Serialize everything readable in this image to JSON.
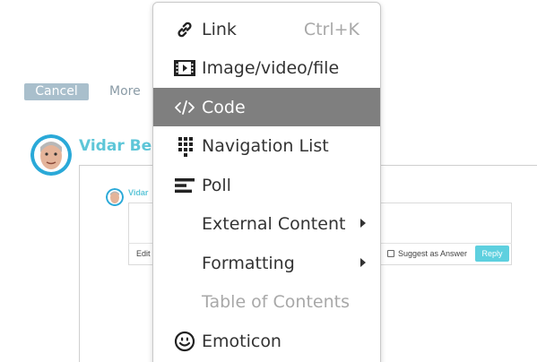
{
  "background": {
    "cancel_label": "Cancel",
    "more_label": "More",
    "author_name": "Vidar Be",
    "author_name_small": "Vidar",
    "edit_label": "Edit",
    "suggest_label": "Suggest as Answer",
    "reply_label": "Reply"
  },
  "menu": {
    "items": [
      {
        "label": "Link",
        "shortcut": "Ctrl+K",
        "icon": "link-icon"
      },
      {
        "label": "Image/video/file",
        "icon": "film-icon"
      },
      {
        "label": "Code",
        "icon": "code-icon",
        "highlighted": true
      },
      {
        "label": "Navigation List",
        "icon": "navigation-list-icon"
      },
      {
        "label": "Poll",
        "icon": "poll-icon"
      },
      {
        "label": "External Content",
        "submenu": true
      },
      {
        "label": "Formatting",
        "submenu": true
      },
      {
        "label": "Table of Contents",
        "disabled": true
      },
      {
        "label": "Emoticon",
        "icon": "smiley-icon"
      }
    ]
  },
  "colors": {
    "accent": "#5ec6d8",
    "highlight": "#7f7f7f",
    "cancel_button": "#a9bfcc",
    "reply_button": "#5ed0df"
  }
}
